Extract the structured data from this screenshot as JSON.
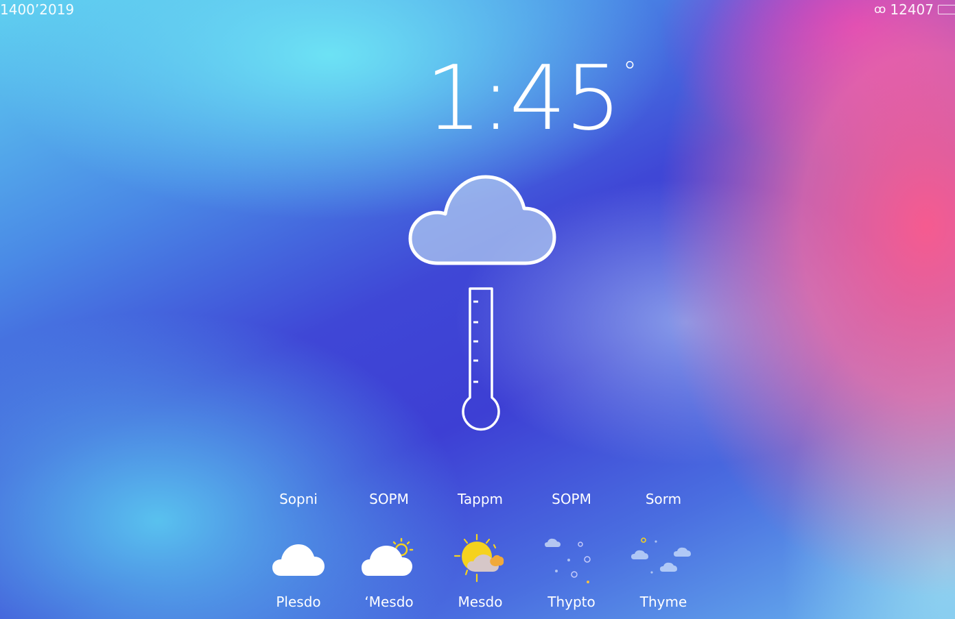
{
  "status_bar": {
    "left_text": "1400’2019",
    "right_text": "12407",
    "right_glyph": "a-icon"
  },
  "current": {
    "temperature": "1:45",
    "degree_symbol": "°",
    "condition_icon": "cloud-icon",
    "gauge_icon": "thermometer-icon"
  },
  "forecast": [
    {
      "time": "Sopni",
      "icon": "cloud-icon",
      "condition": "Plesdo"
    },
    {
      "time": "SOPM",
      "icon": "partly-sunny-cloud-icon",
      "condition": "‘Mesdo"
    },
    {
      "time": "Tappm",
      "icon": "sun-behind-cloud-icon",
      "condition": "Mesdo"
    },
    {
      "time": "SOPM",
      "icon": "scattered-clouds-snow-icon",
      "condition": "Thypto"
    },
    {
      "time": "Sorm",
      "icon": "scattered-clouds-icon",
      "condition": "Thyme"
    }
  ],
  "colors": {
    "background_top_left": "#5fd0f0",
    "background_center": "#3d3fd4",
    "background_right": "#ff5c8c",
    "background_top_right": "#cd28c8",
    "sun": "#f5d21e",
    "text": "#ffffff"
  }
}
